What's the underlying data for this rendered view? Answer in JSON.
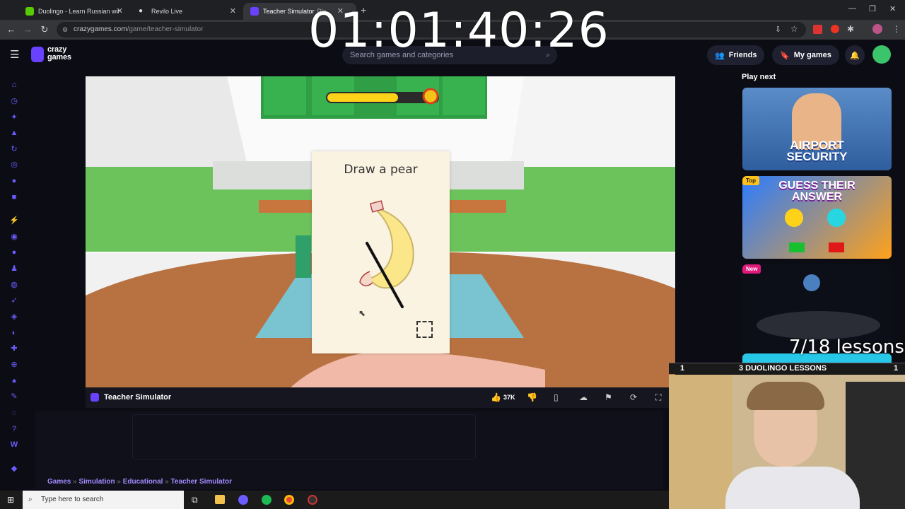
{
  "browser": {
    "tabs": [
      {
        "title": "Duolingo - Learn Russian with M",
        "active": false
      },
      {
        "title": "Revilo Live",
        "active": false
      },
      {
        "title": "Teacher Simulator",
        "suffix": "Pla",
        "active": true
      }
    ],
    "url_domain": "crazygames.com",
    "url_path": "/game/teacher-simulator"
  },
  "stream_timer": "01:01:40:26",
  "site": {
    "logo_line1": "crazy",
    "logo_line2": "games",
    "search_placeholder": "Search games and categories",
    "friends_label": "Friends",
    "mygames_label": "My games"
  },
  "game": {
    "prompt": "Draw a pear",
    "title": "Teacher Simulator",
    "likes": "37K"
  },
  "breadcrumb": [
    "Games",
    "Simulation",
    "Educational",
    "Teacher Simulator"
  ],
  "sidebar": {
    "play_next_label": "Play next",
    "cards": [
      {
        "title_line1": "AIRPORT",
        "title_line2": "SECURITY",
        "badge": ""
      },
      {
        "title_line1": "GUESS THEIR",
        "title_line2": "ANSWER",
        "badge": "Top"
      },
      {
        "title_line1": "",
        "title_line2": "",
        "badge": "New"
      }
    ]
  },
  "overlay": {
    "lessons_progress": "7/18 lessons",
    "duo_bar_left": "1",
    "duo_bar_title": "3 DUOLINGO LESSONS",
    "duo_bar_right": "1"
  },
  "taskbar": {
    "search_placeholder": "Type here to search"
  },
  "colors": {
    "brand_purple": "#6842ff",
    "link_purple": "#a38bff",
    "site_bg": "#0c0d14"
  }
}
